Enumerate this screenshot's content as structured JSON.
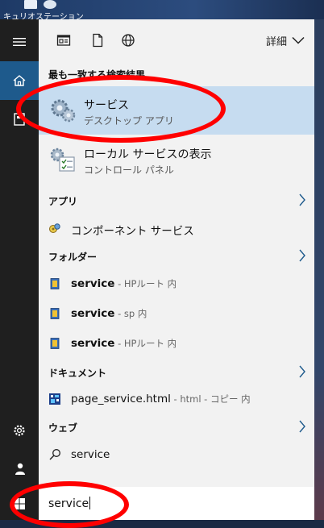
{
  "desktop": {
    "shortcut_label": "キュリオステーション"
  },
  "toolbar": {
    "details_label": "詳細"
  },
  "sections": {
    "best_match": "最も一致する検索結果",
    "apps": "アプリ",
    "folders": "フォルダー",
    "documents": "ドキュメント",
    "web": "ウェブ"
  },
  "best_match": {
    "title": "サービス",
    "subtitle": "デスクトップ アプリ"
  },
  "second_result": {
    "title": "ローカル サービスの表示",
    "subtitle": "コントロール パネル"
  },
  "apps": [
    {
      "label": "コンポーネント サービス"
    }
  ],
  "folders": [
    {
      "name": "service",
      "location": " - HPルート 内"
    },
    {
      "name": "service",
      "location": " - sp 内"
    },
    {
      "name": "service",
      "location": " - HPルート 内"
    }
  ],
  "documents": [
    {
      "name": "page_service.html",
      "location": " - html - コピー 内"
    }
  ],
  "web": [
    {
      "label": "service"
    }
  ],
  "search": {
    "query": "service"
  },
  "colors": {
    "rail": "#1f1f1f",
    "rail_active": "#1e5a8c",
    "panel": "#f2f2f2",
    "selected": "#c6dcf0",
    "annotation": "#ff0000"
  }
}
